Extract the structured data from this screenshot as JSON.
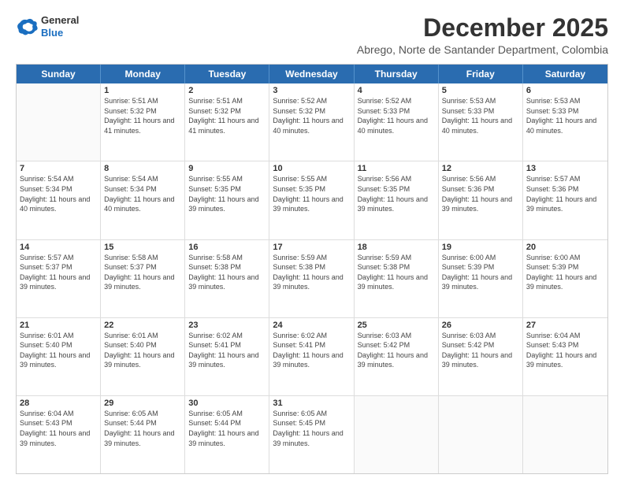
{
  "header": {
    "logo": {
      "line1": "General",
      "line2": "Blue"
    },
    "title": "December 2025",
    "subtitle": "Abrego, Norte de Santander Department, Colombia"
  },
  "calendar": {
    "days_of_week": [
      "Sunday",
      "Monday",
      "Tuesday",
      "Wednesday",
      "Thursday",
      "Friday",
      "Saturday"
    ],
    "weeks": [
      [
        {
          "day": "",
          "empty": true
        },
        {
          "day": "1",
          "sunrise": "Sunrise: 5:51 AM",
          "sunset": "Sunset: 5:32 PM",
          "daylight": "Daylight: 11 hours and 41 minutes."
        },
        {
          "day": "2",
          "sunrise": "Sunrise: 5:51 AM",
          "sunset": "Sunset: 5:32 PM",
          "daylight": "Daylight: 11 hours and 41 minutes."
        },
        {
          "day": "3",
          "sunrise": "Sunrise: 5:52 AM",
          "sunset": "Sunset: 5:32 PM",
          "daylight": "Daylight: 11 hours and 40 minutes."
        },
        {
          "day": "4",
          "sunrise": "Sunrise: 5:52 AM",
          "sunset": "Sunset: 5:33 PM",
          "daylight": "Daylight: 11 hours and 40 minutes."
        },
        {
          "day": "5",
          "sunrise": "Sunrise: 5:53 AM",
          "sunset": "Sunset: 5:33 PM",
          "daylight": "Daylight: 11 hours and 40 minutes."
        },
        {
          "day": "6",
          "sunrise": "Sunrise: 5:53 AM",
          "sunset": "Sunset: 5:33 PM",
          "daylight": "Daylight: 11 hours and 40 minutes."
        }
      ],
      [
        {
          "day": "7",
          "sunrise": "Sunrise: 5:54 AM",
          "sunset": "Sunset: 5:34 PM",
          "daylight": "Daylight: 11 hours and 40 minutes."
        },
        {
          "day": "8",
          "sunrise": "Sunrise: 5:54 AM",
          "sunset": "Sunset: 5:34 PM",
          "daylight": "Daylight: 11 hours and 40 minutes."
        },
        {
          "day": "9",
          "sunrise": "Sunrise: 5:55 AM",
          "sunset": "Sunset: 5:35 PM",
          "daylight": "Daylight: 11 hours and 39 minutes."
        },
        {
          "day": "10",
          "sunrise": "Sunrise: 5:55 AM",
          "sunset": "Sunset: 5:35 PM",
          "daylight": "Daylight: 11 hours and 39 minutes."
        },
        {
          "day": "11",
          "sunrise": "Sunrise: 5:56 AM",
          "sunset": "Sunset: 5:35 PM",
          "daylight": "Daylight: 11 hours and 39 minutes."
        },
        {
          "day": "12",
          "sunrise": "Sunrise: 5:56 AM",
          "sunset": "Sunset: 5:36 PM",
          "daylight": "Daylight: 11 hours and 39 minutes."
        },
        {
          "day": "13",
          "sunrise": "Sunrise: 5:57 AM",
          "sunset": "Sunset: 5:36 PM",
          "daylight": "Daylight: 11 hours and 39 minutes."
        }
      ],
      [
        {
          "day": "14",
          "sunrise": "Sunrise: 5:57 AM",
          "sunset": "Sunset: 5:37 PM",
          "daylight": "Daylight: 11 hours and 39 minutes."
        },
        {
          "day": "15",
          "sunrise": "Sunrise: 5:58 AM",
          "sunset": "Sunset: 5:37 PM",
          "daylight": "Daylight: 11 hours and 39 minutes."
        },
        {
          "day": "16",
          "sunrise": "Sunrise: 5:58 AM",
          "sunset": "Sunset: 5:38 PM",
          "daylight": "Daylight: 11 hours and 39 minutes."
        },
        {
          "day": "17",
          "sunrise": "Sunrise: 5:59 AM",
          "sunset": "Sunset: 5:38 PM",
          "daylight": "Daylight: 11 hours and 39 minutes."
        },
        {
          "day": "18",
          "sunrise": "Sunrise: 5:59 AM",
          "sunset": "Sunset: 5:38 PM",
          "daylight": "Daylight: 11 hours and 39 minutes."
        },
        {
          "day": "19",
          "sunrise": "Sunrise: 6:00 AM",
          "sunset": "Sunset: 5:39 PM",
          "daylight": "Daylight: 11 hours and 39 minutes."
        },
        {
          "day": "20",
          "sunrise": "Sunrise: 6:00 AM",
          "sunset": "Sunset: 5:39 PM",
          "daylight": "Daylight: 11 hours and 39 minutes."
        }
      ],
      [
        {
          "day": "21",
          "sunrise": "Sunrise: 6:01 AM",
          "sunset": "Sunset: 5:40 PM",
          "daylight": "Daylight: 11 hours and 39 minutes."
        },
        {
          "day": "22",
          "sunrise": "Sunrise: 6:01 AM",
          "sunset": "Sunset: 5:40 PM",
          "daylight": "Daylight: 11 hours and 39 minutes."
        },
        {
          "day": "23",
          "sunrise": "Sunrise: 6:02 AM",
          "sunset": "Sunset: 5:41 PM",
          "daylight": "Daylight: 11 hours and 39 minutes."
        },
        {
          "day": "24",
          "sunrise": "Sunrise: 6:02 AM",
          "sunset": "Sunset: 5:41 PM",
          "daylight": "Daylight: 11 hours and 39 minutes."
        },
        {
          "day": "25",
          "sunrise": "Sunrise: 6:03 AM",
          "sunset": "Sunset: 5:42 PM",
          "daylight": "Daylight: 11 hours and 39 minutes."
        },
        {
          "day": "26",
          "sunrise": "Sunrise: 6:03 AM",
          "sunset": "Sunset: 5:42 PM",
          "daylight": "Daylight: 11 hours and 39 minutes."
        },
        {
          "day": "27",
          "sunrise": "Sunrise: 6:04 AM",
          "sunset": "Sunset: 5:43 PM",
          "daylight": "Daylight: 11 hours and 39 minutes."
        }
      ],
      [
        {
          "day": "28",
          "sunrise": "Sunrise: 6:04 AM",
          "sunset": "Sunset: 5:43 PM",
          "daylight": "Daylight: 11 hours and 39 minutes."
        },
        {
          "day": "29",
          "sunrise": "Sunrise: 6:05 AM",
          "sunset": "Sunset: 5:44 PM",
          "daylight": "Daylight: 11 hours and 39 minutes."
        },
        {
          "day": "30",
          "sunrise": "Sunrise: 6:05 AM",
          "sunset": "Sunset: 5:44 PM",
          "daylight": "Daylight: 11 hours and 39 minutes."
        },
        {
          "day": "31",
          "sunrise": "Sunrise: 6:05 AM",
          "sunset": "Sunset: 5:45 PM",
          "daylight": "Daylight: 11 hours and 39 minutes."
        },
        {
          "day": "",
          "empty": true
        },
        {
          "day": "",
          "empty": true
        },
        {
          "day": "",
          "empty": true
        }
      ]
    ]
  }
}
